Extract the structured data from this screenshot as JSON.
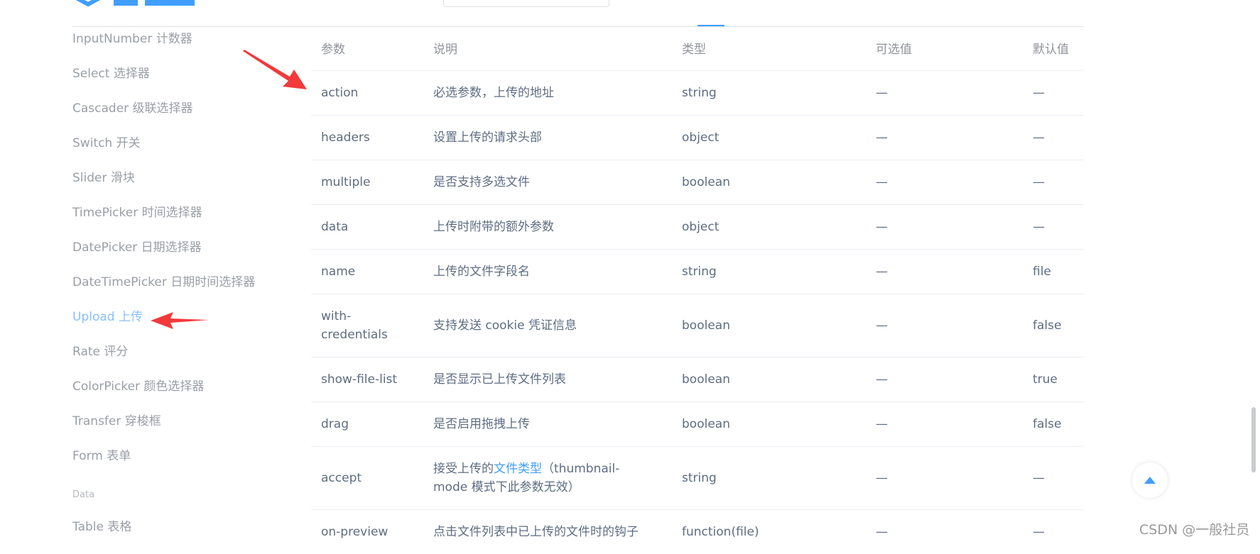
{
  "sidebar": {
    "items": [
      {
        "label": "InputNumber 计数器"
      },
      {
        "label": "Select 选择器"
      },
      {
        "label": "Cascader 级联选择器"
      },
      {
        "label": "Switch 开关"
      },
      {
        "label": "Slider 滑块"
      },
      {
        "label": "TimePicker 时间选择器"
      },
      {
        "label": "DatePicker 日期选择器"
      },
      {
        "label": "DateTimePicker 日期时间选择器"
      },
      {
        "label": "Upload 上传",
        "active": true
      },
      {
        "label": "Rate 评分"
      },
      {
        "label": "ColorPicker 颜色选择器"
      },
      {
        "label": "Transfer 穿梭框"
      },
      {
        "label": "Form 表单"
      }
    ],
    "group_label": "Data",
    "next_item": "Table 表格"
  },
  "table": {
    "headers": [
      "参数",
      "说明",
      "类型",
      "可选值",
      "默认值"
    ],
    "rows": [
      {
        "param": "action",
        "desc": "必选参数，上传的地址",
        "type": "string",
        "options": "—",
        "default": "—"
      },
      {
        "param": "headers",
        "desc": "设置上传的请求头部",
        "type": "object",
        "options": "—",
        "default": "—"
      },
      {
        "param": "multiple",
        "desc": "是否支持多选文件",
        "type": "boolean",
        "options": "—",
        "default": "—"
      },
      {
        "param": "data",
        "desc": "上传时附带的额外参数",
        "type": "object",
        "options": "—",
        "default": "—"
      },
      {
        "param": "name",
        "desc": "上传的文件字段名",
        "type": "string",
        "options": "—",
        "default": "file"
      },
      {
        "param": "with-credentials",
        "desc": "支持发送 cookie 凭证信息",
        "type": "boolean",
        "options": "—",
        "default": "false"
      },
      {
        "param": "show-file-list",
        "desc": "是否显示已上传文件列表",
        "type": "boolean",
        "options": "—",
        "default": "true"
      },
      {
        "param": "drag",
        "desc": "是否启用拖拽上传",
        "type": "boolean",
        "options": "—",
        "default": "false"
      },
      {
        "param": "accept",
        "desc_before": "接受上传的",
        "desc_link": "文件类型",
        "desc_after": "（thumbnail-mode 模式下此参数无效）",
        "type": "string",
        "options": "—",
        "default": "—"
      },
      {
        "param": "on-preview",
        "desc": "点击文件列表中已上传的文件时的钩子",
        "type": "function(file)",
        "options": "—",
        "default": "—"
      }
    ]
  },
  "watermark": "CSDN @一般社员",
  "colors": {
    "accent": "#409eff",
    "active_nav": "#89c0ff",
    "arrow": "#f23a3a"
  },
  "icons": {
    "back_to_top": "caret-up-icon",
    "logo": "element-logo"
  }
}
